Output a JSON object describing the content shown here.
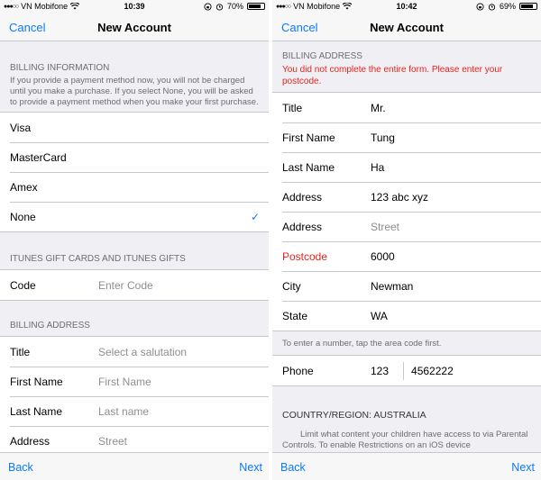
{
  "left": {
    "status": {
      "carrier": "VN Mobifone",
      "time": "10:39",
      "battery": "70%",
      "battery_level": 0.7
    },
    "nav": {
      "cancel": "Cancel",
      "title": "New Account"
    },
    "billing_info": {
      "header": "BILLING INFORMATION",
      "note": "If you provide a payment method now, you will not be charged until you make a purchase. If you select None, you will be asked to provide a payment method when you make your first purchase.",
      "options": [
        "Visa",
        "MasterCard",
        "Amex",
        "None"
      ],
      "selected": "None"
    },
    "gift": {
      "header": "ITUNES GIFT CARDS AND ITUNES GIFTS",
      "code_label": "Code",
      "code_placeholder": "Enter Code"
    },
    "billing_address": {
      "header": "BILLING ADDRESS",
      "rows": [
        {
          "label": "Title",
          "placeholder": "Select a salutation"
        },
        {
          "label": "First Name",
          "placeholder": "First Name"
        },
        {
          "label": "Last Name",
          "placeholder": "Last name"
        },
        {
          "label": "Address",
          "placeholder": "Street"
        }
      ]
    },
    "toolbar": {
      "back": "Back",
      "next": "Next"
    }
  },
  "right": {
    "status": {
      "carrier": "VN Mobifone",
      "time": "10:42",
      "battery": "69%",
      "battery_level": 0.69
    },
    "nav": {
      "cancel": "Cancel",
      "title": "New Account"
    },
    "billing_address": {
      "header": "BILLING ADDRESS",
      "error": "You did not complete the entire form. Please enter your postcode.",
      "rows": [
        {
          "label": "Title",
          "value": "Mr."
        },
        {
          "label": "First Name",
          "value": "Tung"
        },
        {
          "label": "Last Name",
          "value": "Ha"
        },
        {
          "label": "Address",
          "value": "123 abc xyz"
        },
        {
          "label": "Address",
          "placeholder": "Street"
        },
        {
          "label": "Postcode",
          "value": "6000",
          "error": true
        },
        {
          "label": "City",
          "value": "Newman"
        },
        {
          "label": "State",
          "value": "WA"
        }
      ]
    },
    "phone": {
      "note": "To enter a number, tap the area code first.",
      "label": "Phone",
      "area_code": "123",
      "number": "4562222"
    },
    "country": {
      "header": "COUNTRY/REGION: AUSTRALIA",
      "note": "Limit what content your children have access to via Parental Controls. To enable Restrictions on an iOS device"
    },
    "toolbar": {
      "back": "Back",
      "next": "Next"
    }
  },
  "colors": {
    "accent": "#0a7aff",
    "error": "#e7241c",
    "background": "#efeff4"
  },
  "icons": {
    "wifi": "wifi-icon",
    "alarm": "alarm-icon",
    "check": "checkmark-icon"
  }
}
